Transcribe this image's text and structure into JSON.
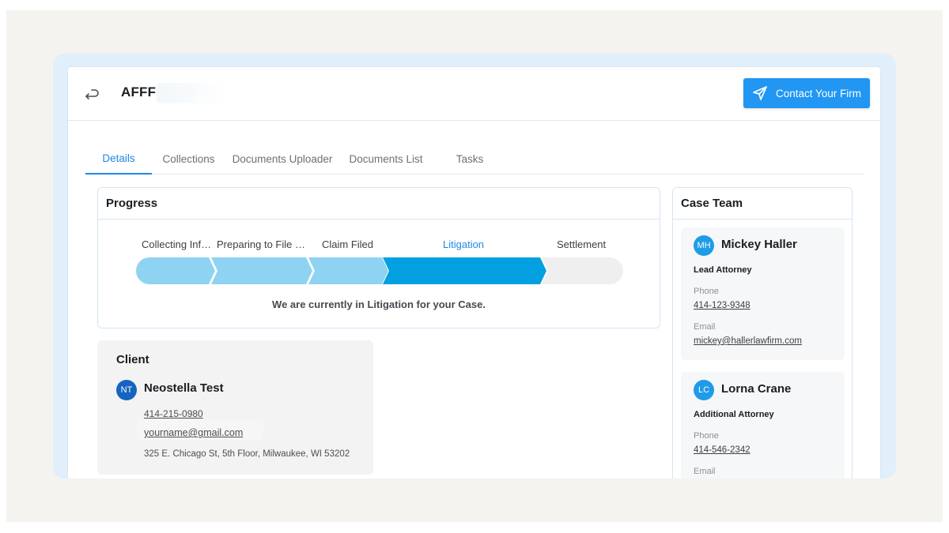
{
  "header": {
    "title": "AFFF",
    "contact_label": "Contact Your Firm"
  },
  "tabs": [
    {
      "label": "Details",
      "active": true
    },
    {
      "label": "Collections",
      "active": false
    },
    {
      "label": "Documents Uploader",
      "active": false
    },
    {
      "label": "Documents List",
      "active": false
    },
    {
      "label": "Tasks",
      "active": false
    }
  ],
  "progress": {
    "title": "Progress",
    "steps": [
      {
        "label": "Collecting Inf…",
        "state": "done"
      },
      {
        "label": "Preparing to File …",
        "state": "done"
      },
      {
        "label": "Claim Filed",
        "state": "done"
      },
      {
        "label": "Litigation",
        "state": "current"
      },
      {
        "label": "Settlement",
        "state": "pending"
      }
    ],
    "message": "We are currently in Litigation for your Case."
  },
  "client": {
    "title": "Client",
    "initials": "NT",
    "name": "Neostella Test",
    "phone": "414-215-0980",
    "email": "yourname@gmail.com",
    "address": "325 E. Chicago St, 5th Floor, Milwaukee, WI 53202"
  },
  "team": {
    "title": "Case Team",
    "members": [
      {
        "initials": "MH",
        "name": "Mickey Haller",
        "role": "Lead Attorney",
        "phone_label": "Phone",
        "phone": "414-123-9348",
        "email_label": "Email",
        "email": "mickey@hallerlawfirm.com"
      },
      {
        "initials": "LC",
        "name": "Lorna Crane",
        "role": "Additional Attorney",
        "phone_label": "Phone",
        "phone": "414-546-2342",
        "email_label": "Email"
      }
    ]
  },
  "colors": {
    "accent": "#2196f3",
    "step_done": "#8fd3f2",
    "step_current": "#02a0e0",
    "step_pending": "#efefef"
  }
}
